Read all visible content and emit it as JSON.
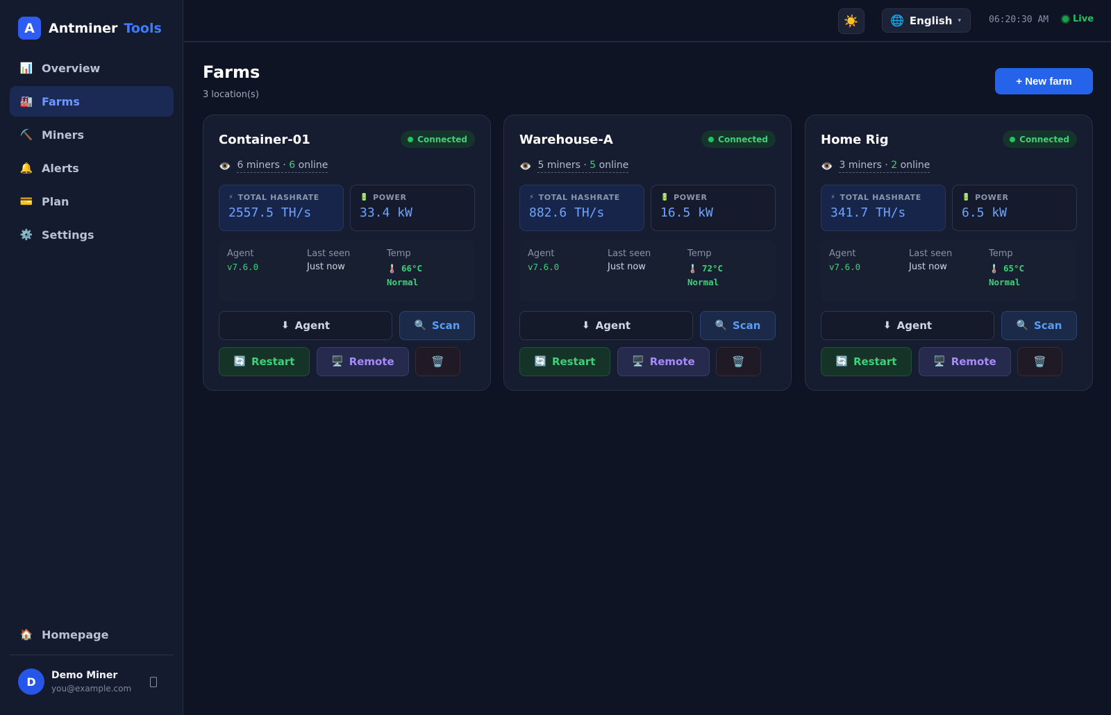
{
  "brand": {
    "logo_letter": "A",
    "name": "Antminer",
    "accent": "Tools",
    "accent_color": "#3f7bff"
  },
  "nav": [
    {
      "label": "Overview",
      "icon": "chart-icon",
      "glyph": "📊",
      "active": false
    },
    {
      "label": "Farms",
      "icon": "factory-icon",
      "glyph": "🏭",
      "active": true
    },
    {
      "label": "Miners",
      "icon": "pickaxe-icon",
      "glyph": "⛏️",
      "active": false
    },
    {
      "label": "Alerts",
      "icon": "bell-icon",
      "glyph": "🔔",
      "active": false
    },
    {
      "label": "Plan",
      "icon": "credit-card-icon",
      "glyph": "💳",
      "active": false
    },
    {
      "label": "Settings",
      "icon": "gear-icon",
      "glyph": "⚙️",
      "active": false
    }
  ],
  "homepage": {
    "label": "Homepage",
    "icon": "house-icon",
    "glyph": "🏠"
  },
  "user": {
    "initial": "D",
    "name": "Demo Miner",
    "email": "you@example.com"
  },
  "topbar": {
    "theme_glyph": "☀️",
    "language": "English",
    "globe_glyph": "🌐",
    "chevron_glyph": "▾",
    "time": "06:20:30 AM",
    "live": "Live"
  },
  "page": {
    "title": "Farms",
    "subtitle": "3 location(s)",
    "new_farm_label": "+ New farm"
  },
  "labels": {
    "total_hashrate": "TOTAL HASHRATE",
    "power": "POWER",
    "agent": "Agent",
    "last_seen": "Last seen",
    "temp": "Temp",
    "btn_agent": "Agent",
    "btn_scan": "Scan",
    "btn_restart": "Restart",
    "btn_remote": "Remote",
    "miners_word": "miners",
    "online_word": "online",
    "separator": "·"
  },
  "glyphs": {
    "eye": "👁️",
    "bolt": "⚡",
    "battery": "🔋",
    "thermometer": "🌡️",
    "download": "⬇",
    "search": "🔍",
    "restart": "🔄",
    "remote": "🖥️",
    "trash": "🗑️"
  },
  "status_color": "#22c55e",
  "farms": [
    {
      "name": "Container-01",
      "status": "Connected",
      "miners": "6",
      "online": "6",
      "hashrate": "2557.5 TH/s",
      "power": "33.4 kW",
      "agent_version": "v7.6.0",
      "last_seen": "Just now",
      "temp": "66°C",
      "temp_status": "Normal"
    },
    {
      "name": "Warehouse-A",
      "status": "Connected",
      "miners": "5",
      "online": "5",
      "hashrate": "882.6 TH/s",
      "power": "16.5 kW",
      "agent_version": "v7.6.0",
      "last_seen": "Just now",
      "temp": "72°C",
      "temp_status": "Normal"
    },
    {
      "name": "Home Rig",
      "status": "Connected",
      "miners": "3",
      "online": "2",
      "hashrate": "341.7 TH/s",
      "power": "6.5 kW",
      "agent_version": "v7.6.0",
      "last_seen": "Just now",
      "temp": "65°C",
      "temp_status": "Normal"
    }
  ]
}
